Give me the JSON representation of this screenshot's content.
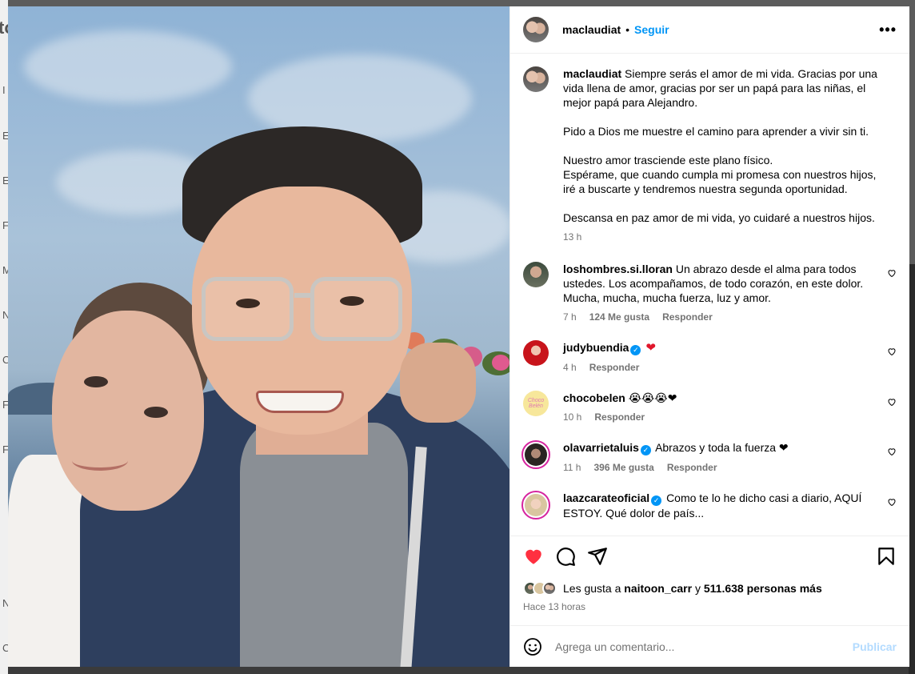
{
  "background_letters": [
    "to",
    "I",
    "E",
    "E",
    "F",
    "M",
    "N",
    "C",
    "F",
    "F",
    "N",
    "C"
  ],
  "post": {
    "username": "maclaudiat",
    "follow_label": "Seguir",
    "more_label": "•••",
    "caption": "Siempre serás el amor de mi vida. Gracias por una vida llena de amor, gracias por ser un papá para las niñas, el mejor papá para Alejandro.\n\nPido a Dios me muestre el camino para aprender a vivir sin ti.\n\nNuestro amor trasciende este plano físico.\nEspérame, que cuando cumpla mi promesa con nuestros hijos, iré a buscarte y tendremos nuestra segunda oportunidad.\n\nDescansa en paz amor de mi vida, yo cuidaré a nuestros hijos.",
    "caption_time": "13 h"
  },
  "comments": [
    {
      "user": "loshombres.si.lloran",
      "text": "Un abrazo desde el alma para todos ustedes. Los acompañamos, de todo corazón, en este dolor. Mucha, mucha, mucha fuerza, luz y amor.",
      "time": "7 h",
      "likes": "124 Me gusta",
      "reply": "Responder"
    },
    {
      "user": "judybuendia",
      "text": "❤",
      "time": "4 h",
      "reply": "Responder"
    },
    {
      "user": "chocobelen",
      "text": "😭😭😭❤",
      "time": "10 h",
      "reply": "Responder",
      "avatar_text": "Choco Belén"
    },
    {
      "user": "olavarrietaluis",
      "text": "Abrazos y toda la fuerza ❤",
      "time": "11 h",
      "likes": "396 Me gusta",
      "reply": "Responder"
    },
    {
      "user": "laazcarateoficial",
      "text": "Como te lo he dicho casi a diario, AQUÍ ESTOY. Qué dolor de país..."
    }
  ],
  "likes": {
    "prefix": "Les gusta a",
    "user": "naitoon_carr",
    "joiner": "y",
    "count": "511.638 personas más"
  },
  "posted_ago": "Hace 13 horas",
  "comment_box": {
    "placeholder": "Agrega un comentario...",
    "publish_label": "Publicar"
  },
  "colors": {
    "accent": "#0095f6",
    "like_red": "#ff3040",
    "muted": "#737373"
  }
}
